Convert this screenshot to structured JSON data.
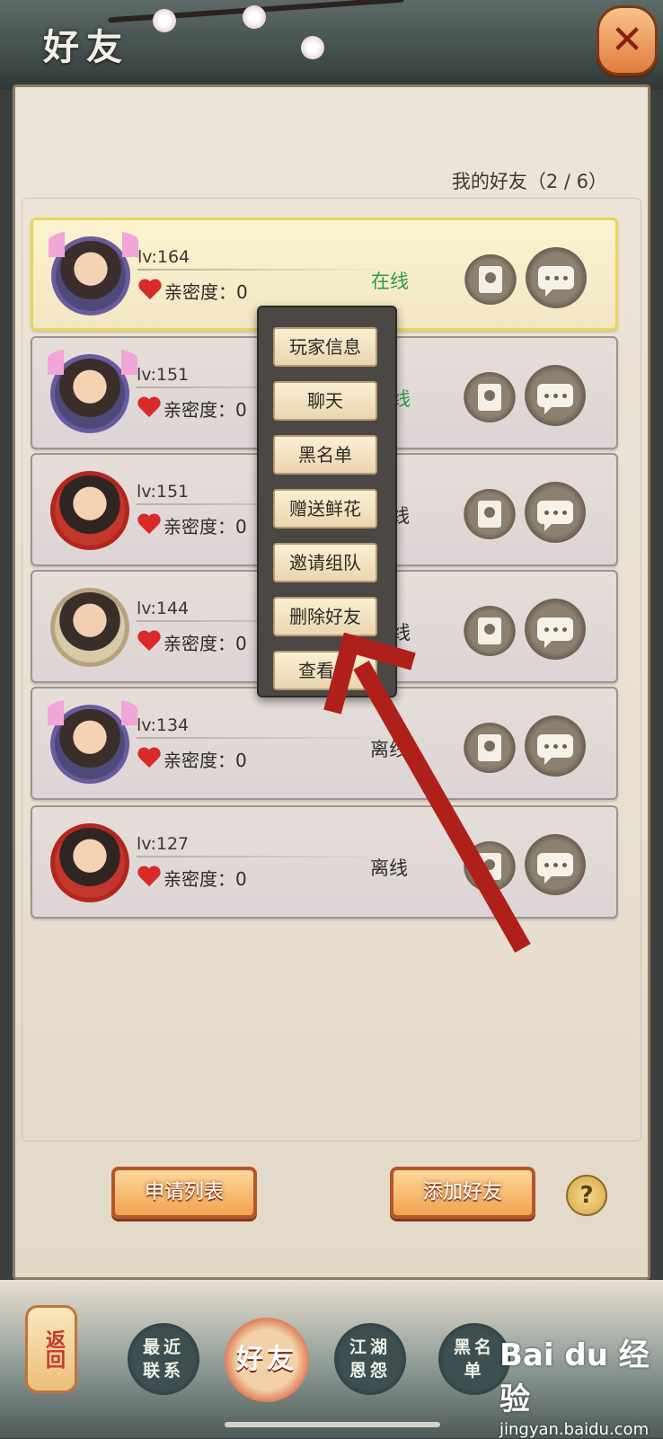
{
  "header": {
    "title": "好友"
  },
  "friends_count_label": "我的好友（2 / 6）",
  "friends": [
    {
      "level": "lv:164",
      "intimacy": "亲密度：0",
      "status": "在线",
      "online": true
    },
    {
      "level": "lv:151",
      "intimacy": "亲密度：0",
      "status": "线",
      "online": true
    },
    {
      "level": "lv:151",
      "intimacy": "亲密度：0",
      "status": "离线",
      "online": false
    },
    {
      "level": "lv:144",
      "intimacy": "亲密度：0",
      "status": "线",
      "online": false
    },
    {
      "level": "lv:134",
      "intimacy": "亲密度：0",
      "status": "离线",
      "online": false
    },
    {
      "level": "lv:127",
      "intimacy": "亲密度：0",
      "status": "离线",
      "online": false
    }
  ],
  "context_menu": {
    "items": [
      "玩家信息",
      "聊天",
      "黑名单",
      "赠送鲜花",
      "邀请组队",
      "删除好友",
      "查看名"
    ]
  },
  "footer": {
    "apply_list": "申请列表",
    "add_friend": "添加好友",
    "help": "?"
  },
  "nav": {
    "back": "返回",
    "tabs": [
      "最近联系",
      "好友",
      "江湖恩怨",
      "黑名单"
    ]
  },
  "watermark": {
    "logo": "Bai du 经验",
    "sub": "jingyan.baidu.com"
  },
  "colors": {
    "online": "#2e9a4c",
    "arrow": "#b0201a",
    "accent": "#f2a24f"
  }
}
